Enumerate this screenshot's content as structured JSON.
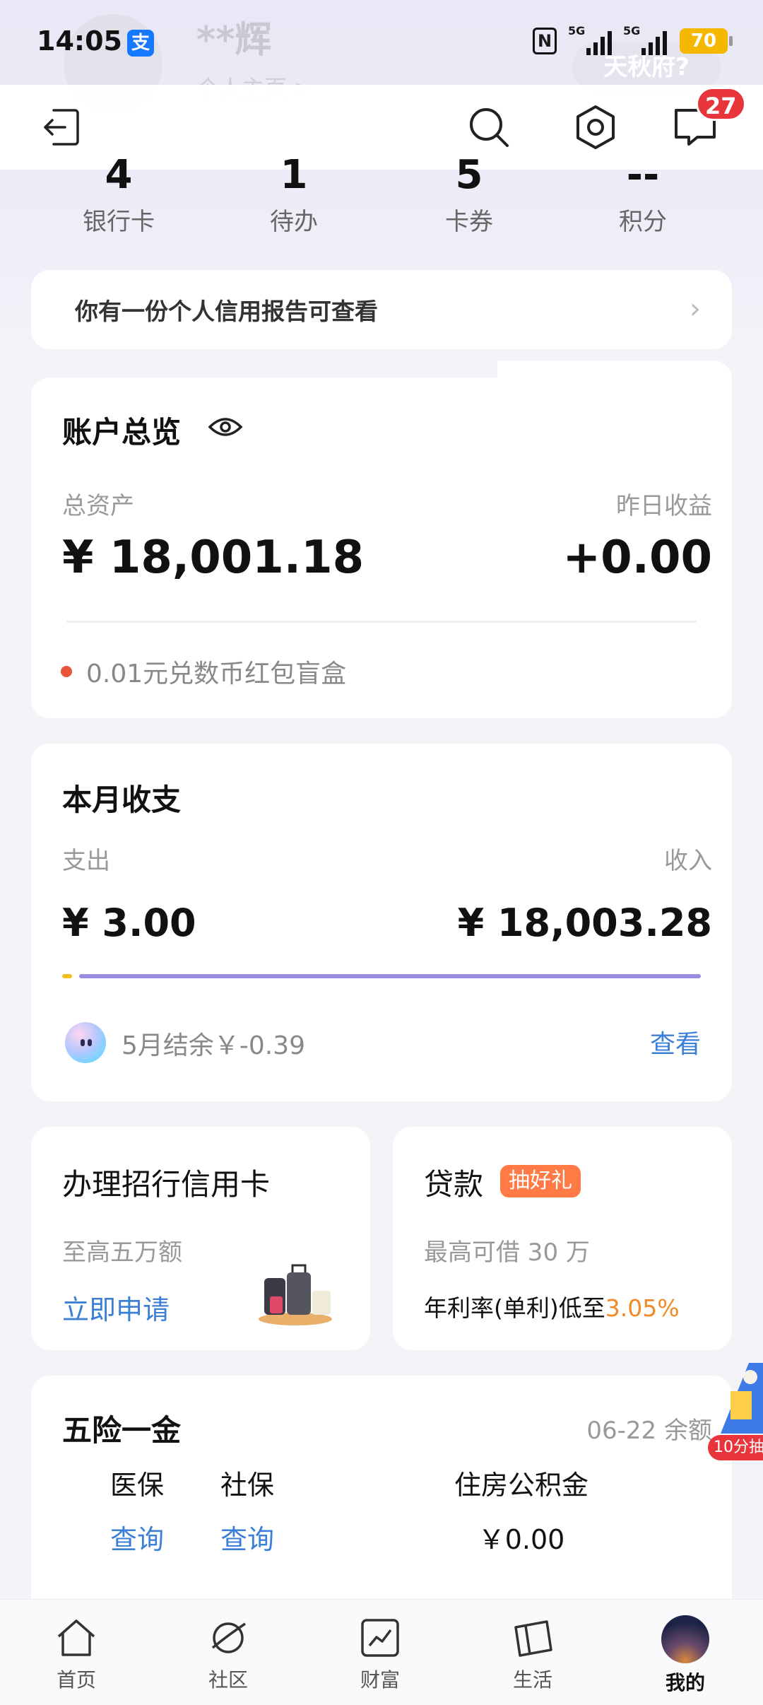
{
  "status_bar": {
    "time": "14:05",
    "app_badge": "支",
    "network_1": "5G",
    "network_2": "5G",
    "battery": "70",
    "nfc": "N"
  },
  "profile": {
    "name": "**辉",
    "subtitle": "个人主页 >",
    "action_button": "天秋府?"
  },
  "header": {
    "message_badge": "27",
    "icons": [
      "logout-icon",
      "search-icon",
      "gear-icon",
      "message-icon"
    ]
  },
  "stats": [
    {
      "num": "4",
      "label": "银行卡"
    },
    {
      "num": "1",
      "label": "待办"
    },
    {
      "num": "5",
      "label": "卡券"
    },
    {
      "num": "--",
      "label": "积分"
    }
  ],
  "credit_banner": {
    "text": "你有一份个人信用报告可查看",
    "arrow": "›"
  },
  "account": {
    "title": "账户总览",
    "total_label": "总资产",
    "total_value": "¥ 18,001.18",
    "yesterday_label": "昨日收益",
    "yesterday_value": "+0.00",
    "promo_text": "0.01元兑数币红包盲盒"
  },
  "month": {
    "title": "本月收支",
    "expense_label": "支出",
    "expense_value": "¥ 3.00",
    "income_label": "收入",
    "income_value": "¥ 18,003.28",
    "balance_text": "5月结余￥-0.39",
    "view_link": "查看"
  },
  "promo_left": {
    "title": "办理招行信用卡",
    "subtitle": "至高五万额",
    "link": "立即申请"
  },
  "promo_right": {
    "title": "贷款",
    "tag": "抽好礼",
    "subtitle": "最高可借 30 万",
    "rate_prefix": "年利率(单利)低至",
    "rate_value": "3.05%"
  },
  "insurance": {
    "title": "五险一金",
    "date_text": "06-22 余额",
    "items": [
      {
        "title": "医保",
        "value": "查询"
      },
      {
        "title": "社保",
        "value": "查询"
      },
      {
        "title": "住房公积金",
        "value": "￥0.00"
      }
    ],
    "float_tag": "10分抽"
  },
  "bottom_nav": [
    {
      "label": "首页",
      "icon": "home-icon"
    },
    {
      "label": "社区",
      "icon": "planet-icon"
    },
    {
      "label": "财富",
      "icon": "chart-icon"
    },
    {
      "label": "生活",
      "icon": "ticket-icon"
    },
    {
      "label": "我的",
      "icon": "avatar"
    }
  ],
  "colors": {
    "accent_link": "#3c7fd6",
    "badge_red": "#e8353b",
    "rate_orange": "#f08a24",
    "income_bar": "#9b8ce0",
    "expense_bar": "#f0c020"
  }
}
